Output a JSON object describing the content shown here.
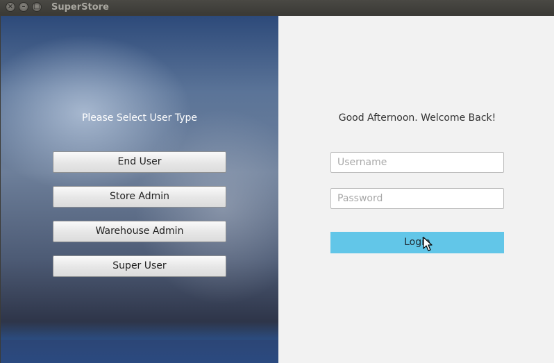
{
  "window": {
    "title": "SuperStore",
    "controls": {
      "close": "×",
      "minimize": "–",
      "maximize": "□"
    }
  },
  "left": {
    "heading": "Please Select User Type",
    "user_types": [
      {
        "label": "End User"
      },
      {
        "label": "Store Admin"
      },
      {
        "label": "Warehouse Admin"
      },
      {
        "label": "Super User"
      }
    ]
  },
  "right": {
    "greeting": "Good Afternoon. Welcome Back!",
    "username": {
      "placeholder": "Username",
      "value": ""
    },
    "password": {
      "placeholder": "Password",
      "value": ""
    },
    "login_label": "Login"
  },
  "colors": {
    "login_button": "#62c6e8",
    "right_background": "#f2f2f2",
    "titlebar": "#3c3b37"
  },
  "icons": {
    "cursor": "arrow-cursor-icon"
  }
}
